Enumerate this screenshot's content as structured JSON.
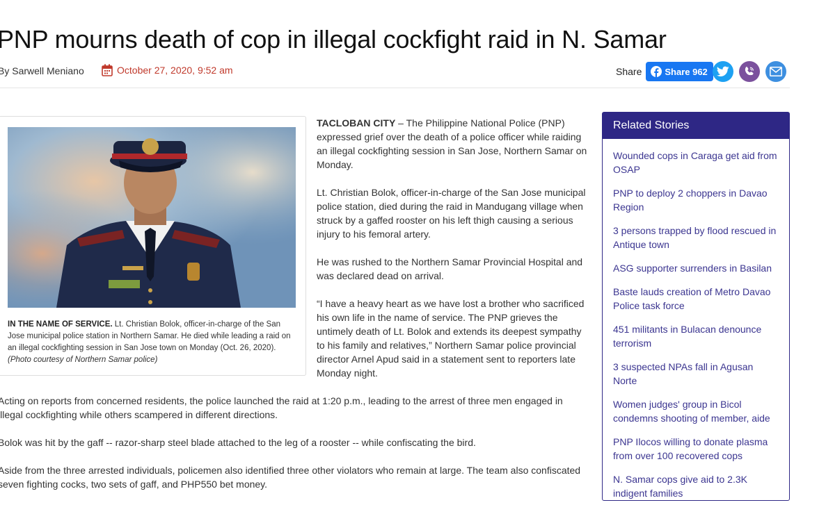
{
  "article": {
    "title": "PNP mourns death of cop in illegal cockfight raid in N. Samar",
    "author": "By Sarwell Meniano",
    "date": "October 27, 2020, 9:52 am"
  },
  "share": {
    "label": "Share",
    "fb_label": "Share 962"
  },
  "figure": {
    "caption_bold": "IN THE NAME OF SERVICE.",
    "caption_text": " Lt. Christian Bolok, officer-in-charge of the San Jose municipal police station in Northern Samar. He died while leading a raid on an illegal cockfighting session in San Jose town on Monday (Oct. 26, 2020). ",
    "caption_credit": "(Photo courtesy of Northern Samar police)"
  },
  "body": {
    "dateline": "TACLOBAN CITY",
    "p1_rest": " – The Philippine National Police (PNP) expressed grief over the death of a police officer while raiding an illegal cockfighting session in San Jose, Northern Samar on Monday.",
    "p2": "Lt. Christian Bolok, officer-in-charge of the San Jose municipal police station, died during the raid in Mandugang village when struck by a gaffed rooster on his left thigh causing a serious injury to his femoral artery.",
    "p3": "He was rushed to the Northern Samar Provincial Hospital and was declared dead on arrival.",
    "p4": "“I have a heavy heart as we have lost a brother who sacrificed his own life in the name of service. The PNP grieves the untimely death of Lt. Bolok and extends its deepest sympathy to his family and relatives,” Northern Samar police provincial director Arnel Apud said in a statement sent to reporters late Monday night.",
    "p5": "Acting on reports from concerned residents, the police launched the raid at 1:20 p.m., leading to the arrest of three men engaged in illegal cockfighting while others scampered in different directions.",
    "p6": "Bolok was hit by the gaff -- razor-sharp steel blade attached to the leg of a rooster -- while confiscating the bird.",
    "p7": "Aside from the three arrested individuals, policemen also identified three other violators who remain at large. The team also confiscated seven fighting cocks, two sets of gaff, and PHP550 bet money."
  },
  "related": {
    "heading": "Related Stories",
    "items": [
      "Wounded cops in Caraga get aid from OSAP",
      "PNP to deploy 2 choppers in Davao Region",
      "3 persons trapped by flood rescued in Antique town",
      "ASG supporter surrenders in Basilan",
      "Baste lauds creation of Metro Davao Police task force",
      "451 militants in Bulacan denounce terrorism",
      "3 suspected NPAs fall in Agusan Norte",
      "Women judges' group in Bicol condemns shooting of member, aide",
      "PNP Ilocos willing to donate plasma from over 100 recovered cops",
      "N. Samar cops give aid to 2.3K indigent families"
    ]
  },
  "colors": {
    "date": "#c0392b",
    "facebook": "#1877f2",
    "twitter": "#1da1f2",
    "viber": "#7b519d",
    "email": "#3d8fe0",
    "related_header": "#2e2785",
    "related_link": "#3b3590"
  },
  "icons": [
    "calendar-icon",
    "facebook-icon",
    "twitter-icon",
    "viber-icon",
    "email-icon"
  ]
}
